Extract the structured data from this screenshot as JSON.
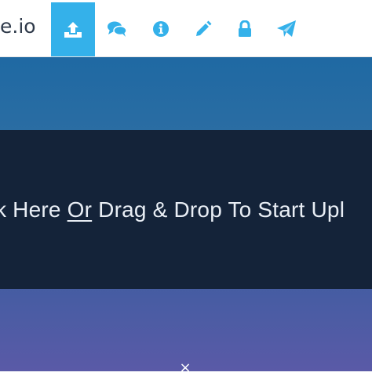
{
  "header": {
    "brand": "e.io",
    "nav": [
      {
        "icon": "upload-icon",
        "active": true
      },
      {
        "icon": "comments-icon",
        "active": false
      },
      {
        "icon": "info-icon",
        "active": false
      },
      {
        "icon": "pencil-icon",
        "active": false
      },
      {
        "icon": "lock-icon",
        "active": false
      },
      {
        "icon": "send-icon",
        "active": false
      }
    ],
    "colors": {
      "active_bg": "#34b1ea",
      "icon": "#34b1ea",
      "active_icon": "#ffffff"
    }
  },
  "dropzone": {
    "text_before": "k Here ",
    "text_or": "Or",
    "text_after": " Drag & Drop To Start Upl",
    "colors": {
      "bg": "#142339",
      "text": "#e9eef5"
    }
  },
  "footer": {
    "close_glyph": "×"
  }
}
